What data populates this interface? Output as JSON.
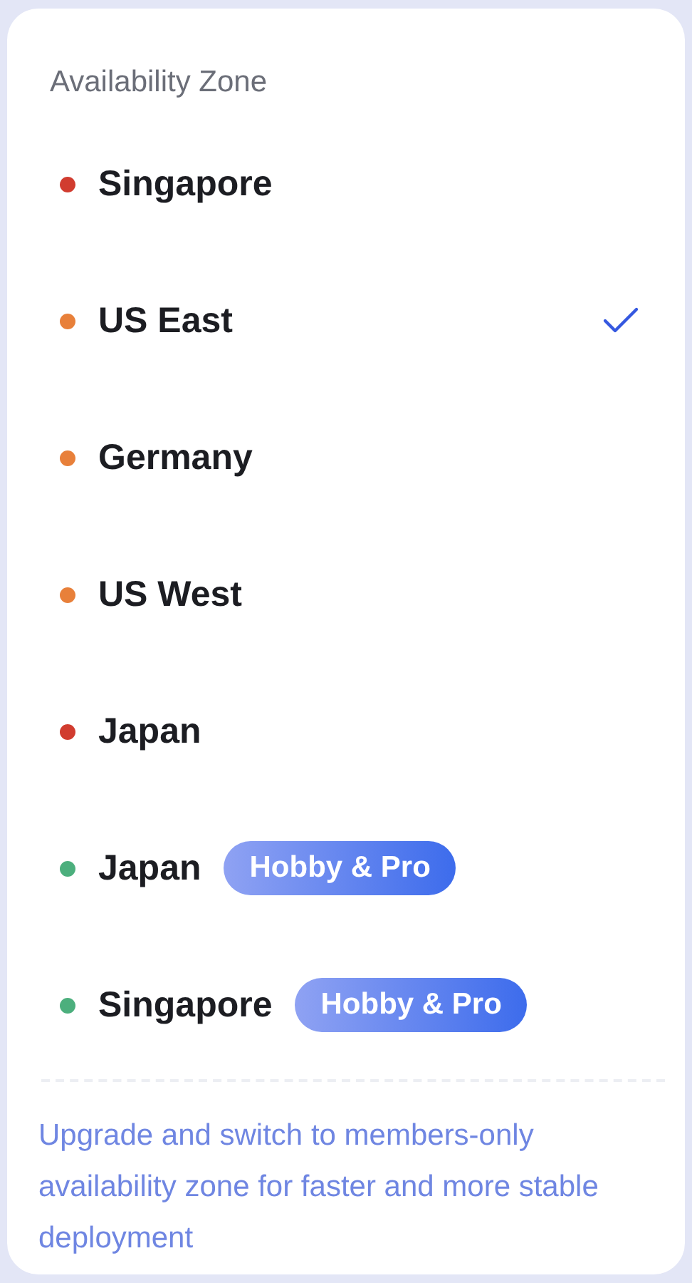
{
  "header": "Availability Zone",
  "zones": [
    {
      "name": "Singapore",
      "color": "#d13c2f",
      "selected": false
    },
    {
      "name": "US East",
      "color": "#e8803a",
      "selected": true
    },
    {
      "name": "Germany",
      "color": "#e8803a",
      "selected": false
    },
    {
      "name": "US West",
      "color": "#e8803a",
      "selected": false
    },
    {
      "name": "Japan",
      "color": "#d13c2f",
      "selected": false
    },
    {
      "name": "Japan",
      "color": "#4caf7d",
      "selected": false,
      "badge": "Hobby & Pro"
    },
    {
      "name": "Singapore",
      "color": "#4caf7d",
      "selected": false,
      "badge": "Hobby & Pro"
    }
  ],
  "footer": "Upgrade and switch to members-only availability zone for faster and more stable deployment"
}
